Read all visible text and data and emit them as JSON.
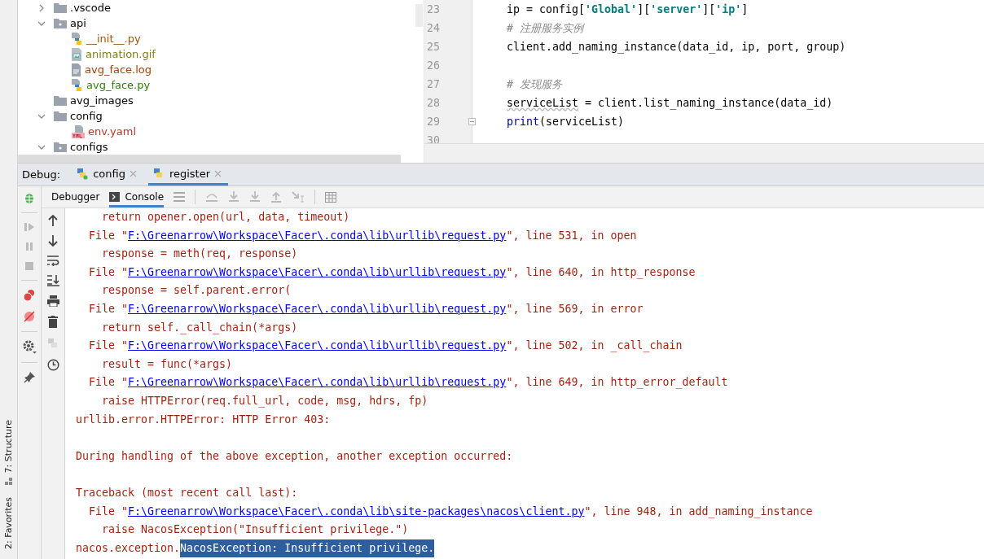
{
  "side_strip": [
    {
      "label": "7: Structure",
      "kind": "structure"
    },
    {
      "label": "2: Favorites",
      "kind": "favorites"
    }
  ],
  "project_tree": [
    {
      "name": ".vscode",
      "kind": "folder",
      "expanded": false,
      "color": "#000000"
    },
    {
      "name": "api",
      "kind": "package",
      "expanded": true,
      "color": "#000000",
      "children": [
        {
          "name": "__init__.py",
          "kind": "python",
          "color": "#a0520a"
        },
        {
          "name": "animation.gif",
          "kind": "image",
          "color": "#7d7d1a"
        },
        {
          "name": "avg_face.log",
          "kind": "text",
          "color": "#a0420a"
        },
        {
          "name": "avg_face.py",
          "kind": "python",
          "color": "#2d7d0a"
        }
      ]
    },
    {
      "name": "avg_images",
      "kind": "folder",
      "color": "#000000"
    },
    {
      "name": "config",
      "kind": "folder",
      "expanded": true,
      "color": "#000000",
      "children": [
        {
          "name": "env.yaml",
          "kind": "yaml",
          "color": "#b03a2a"
        }
      ]
    },
    {
      "name": "configs",
      "kind": "package",
      "expanded": true,
      "color": "#000000"
    }
  ],
  "editor": {
    "lines": [
      {
        "number": "23",
        "tokens": [
          {
            "kind": "plain",
            "text": "ip = config["
          },
          {
            "kind": "string",
            "text": "'Global'"
          },
          {
            "kind": "plain",
            "text": "]["
          },
          {
            "kind": "string",
            "text": "'server'"
          },
          {
            "kind": "plain",
            "text": "]["
          },
          {
            "kind": "string",
            "text": "'ip'"
          },
          {
            "kind": "plain",
            "text": "]"
          }
        ]
      },
      {
        "number": "24",
        "tokens": [
          {
            "kind": "comment",
            "text": "# 注册服务实例"
          }
        ]
      },
      {
        "number": "25",
        "tokens": [
          {
            "kind": "plain",
            "text": "client.add_naming_instance(data_id, ip, port, group)"
          }
        ]
      },
      {
        "number": "26"
      },
      {
        "number": "27",
        "tokens": [
          {
            "kind": "comment",
            "text": "# 发现服务"
          }
        ]
      },
      {
        "number": "28",
        "tokens": [
          {
            "kind": "typo",
            "text": "serviceList"
          },
          {
            "kind": "plain",
            "text": " = client.list_naming_instance(data_id)"
          }
        ]
      },
      {
        "number": "29",
        "fold": true,
        "tokens": [
          {
            "kind": "builtin",
            "text": "print"
          },
          {
            "kind": "plain",
            "text": "(serviceList)"
          }
        ]
      },
      {
        "number": "30"
      }
    ]
  },
  "debug_bar": {
    "label": "Debug:",
    "tabs": [
      {
        "label": "config",
        "selected": false,
        "running": true
      },
      {
        "label": "register",
        "selected": true,
        "running": false
      }
    ]
  },
  "debug_toolbar": {
    "tabs": [
      {
        "label": "Debugger",
        "selected": false
      },
      {
        "label": "Console",
        "selected": true
      }
    ]
  },
  "console": [
    {
      "kind": "code",
      "text": "return opener.open(url, data, timeout)"
    },
    {
      "kind": "file",
      "prefix": "File \"",
      "link": "F:\\Greenarrow\\Workspace\\Facer\\.conda\\lib\\urllib\\request.py",
      "suffix": "\", line 531, in open"
    },
    {
      "kind": "code",
      "text": "response = meth(req, response)"
    },
    {
      "kind": "file",
      "prefix": "File \"",
      "link": "F:\\Greenarrow\\Workspace\\Facer\\.conda\\lib\\urllib\\request.py",
      "suffix": "\", line 640, in http_response"
    },
    {
      "kind": "code",
      "text": "response = self.parent.error("
    },
    {
      "kind": "file",
      "prefix": "File \"",
      "link": "F:\\Greenarrow\\Workspace\\Facer\\.conda\\lib\\urllib\\request.py",
      "suffix": "\", line 569, in error"
    },
    {
      "kind": "code",
      "text": "return self._call_chain(*args)"
    },
    {
      "kind": "file",
      "prefix": "File \"",
      "link": "F:\\Greenarrow\\Workspace\\Facer\\.conda\\lib\\urllib\\request.py",
      "suffix": "\", line 502, in _call_chain"
    },
    {
      "kind": "code",
      "text": "result = func(*args)"
    },
    {
      "kind": "file",
      "prefix": "File \"",
      "link": "F:\\Greenarrow\\Workspace\\Facer\\.conda\\lib\\urllib\\request.py",
      "suffix": "\", line 649, in http_error_default"
    },
    {
      "kind": "code",
      "text": "raise HTTPError(req.full_url, code, msg, hdrs, fp)"
    },
    {
      "kind": "plain",
      "text": "urllib.error.HTTPError: HTTP Error 403:"
    },
    {
      "kind": "blank"
    },
    {
      "kind": "plain",
      "text": "During handling of the above exception, another exception occurred:"
    },
    {
      "kind": "blank"
    },
    {
      "kind": "plain",
      "text": "Traceback (most recent call last):"
    },
    {
      "kind": "file",
      "prefix": "File \"",
      "link": "F:\\Greenarrow\\Workspace\\Facer\\.conda\\lib\\site-packages\\nacos\\client.py",
      "suffix": "\", line 948, in add_naming_instance"
    },
    {
      "kind": "code",
      "text": "raise NacosException(\"Insufficient privilege.\")"
    },
    {
      "kind": "selection",
      "text": "nacos.exception.",
      "selected_text": "NacosException: Insufficient privilege."
    }
  ]
}
